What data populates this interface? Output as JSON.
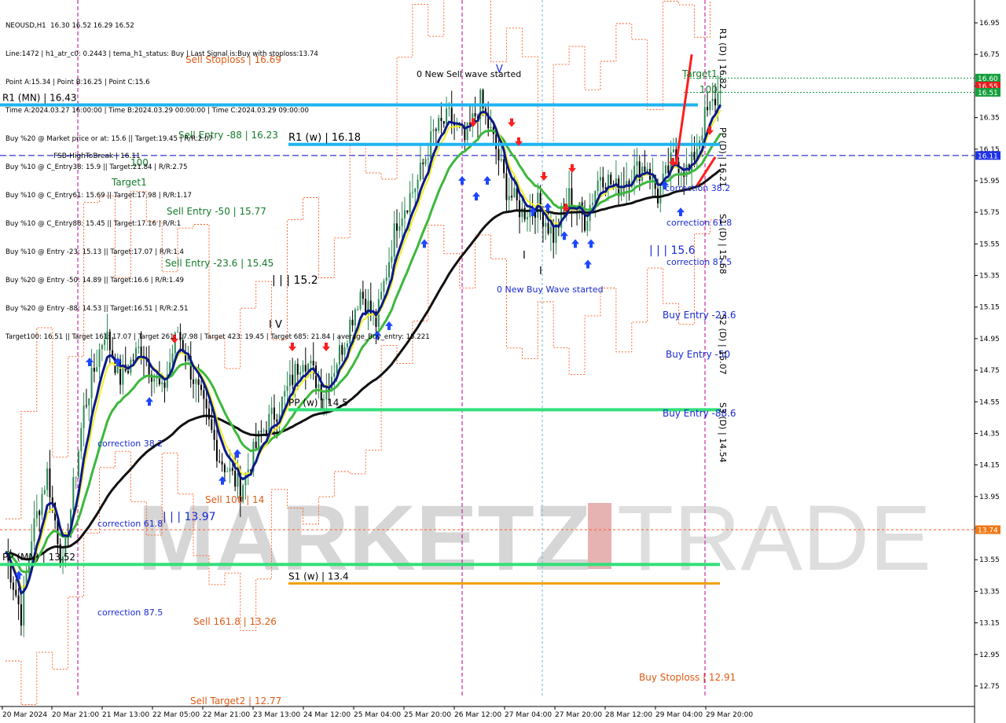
{
  "header": {
    "symbol_line": "NEOUSD,H1  16.30 16.52 16.29 16.52",
    "lines": [
      "Line:1472 | h1_atr_c0: 0.2443 | tema_h1_status: Buy | Last Signal is:Buy with stoploss:13.74",
      "Point A:15.34 | Point B:16.25 | Point C:15.6",
      "Time A:2024.03.27 16:00:00 | Time B:2024.03.29 00:00:00 | Time C:2024.03.29 09:00:00",
      "Buy %20 @ Market price or at: 15.6 || Target:19.45 | R/R:2.07",
      "Buy %10 @ C_Entry38: 15.9 || Target:21.84 | R/R:2.75",
      "Buy %10 @ C_Entry61: 15.69 || Target:17.98 | R/R:1.17",
      "Buy %10 @ C_Entry88: 15.45 || Target:17.16 | R/R:1",
      "Buy %10 @ Entry -23: 15.13 || Target:17.07 | R/R:1.4",
      "Buy %20 @ Entry -50: 14.89 || Target:16.6 | R/R:1.49",
      "Buy %20 @ Entry -88: 14.53 || Target:16.51 | R/R:2.51",
      "Target100: 16.51 || Target 161: 17.07 | Target 261: 17.98 | Target 423: 19.45 | Target 685: 21.84 | average_Buy_entry: 15.221"
    ]
  },
  "watermark": {
    "left": "MARKETZ",
    "right": "TRADE"
  },
  "colors": {
    "bull": "#2e8b57",
    "bear": "#000000",
    "ma_black": "#111111",
    "ma_navy": "#0a1a8a",
    "ma_yellow": "#f2ee1e",
    "ma_green": "#3cb83c",
    "level_blue": "#1eb4f0",
    "level_green": "#32e07a",
    "level_orange": "#f0a000",
    "fsb_dash": "#0000cc",
    "dotted_red": "#ff5a1e",
    "magenta": "#c0008c",
    "arrow_up": "#1e46ff",
    "arrow_down": "#ff1e1e"
  },
  "chart_data": {
    "type": "candlestick",
    "symbol": "NEOUSD",
    "timeframe": "H1",
    "ylim": [
      12.68,
      17.02
    ],
    "y_ticks": [
      16.95,
      16.75,
      16.55,
      16.35,
      16.15,
      15.95,
      15.75,
      15.55,
      15.35,
      15.15,
      14.95,
      14.75,
      14.55,
      14.35,
      14.15,
      13.95,
      13.75,
      13.55,
      13.35,
      13.15,
      12.95,
      12.75
    ],
    "x_labels": [
      "20 Mar 2024",
      "20 Mar 21:00",
      "21 Mar 13:00",
      "22 Mar 05:00",
      "22 Mar 21:00",
      "23 Mar 13:00",
      "24 Mar 12:00",
      "25 Mar 04:00",
      "25 Mar 20:00",
      "26 Mar 12:00",
      "27 Mar 04:00",
      "27 Mar 20:00",
      "28 Mar 12:00",
      "29 Mar 04:00",
      "29 Mar 20:00"
    ],
    "price_tags": [
      {
        "value": 16.6,
        "label": "16.60",
        "color": "#14a03c"
      },
      {
        "value": 16.55,
        "label": "16.55",
        "color": "#e61e1e"
      },
      {
        "value": 16.51,
        "label": "16.51",
        "color": "#14a03c"
      },
      {
        "value": 16.11,
        "label": "16.11",
        "color": "#1e32e6"
      },
      {
        "value": 13.74,
        "label": "13.74",
        "color": "#f07814"
      }
    ],
    "levels": [
      {
        "name": "R1 (w)",
        "value": 16.18,
        "label": "R1 (w) | 16.18"
      },
      {
        "name": "PP (w)",
        "value": 14.5,
        "label": "PP (w) | 14.5"
      },
      {
        "name": "S1 (w)",
        "value": 13.4,
        "label": "S1 (w) | 13.4"
      },
      {
        "name": "PP (MN)",
        "value": 13.52,
        "label": "PP (MN) | 13.52"
      },
      {
        "name": "R1 (MN)",
        "value": 16.43,
        "label": "R1 (MN) | 16.43"
      },
      {
        "name": "FSB-HighToBreak",
        "value": 16.11,
        "label": "FSB-HighToBreak | 16.11"
      }
    ],
    "annotations": {
      "sell_stoploss": "Sell Stoploss | 16.69",
      "sell_entry_88": "Sell Entry -88 | 16.23",
      "sell_entry_50": "Sell Entry -50 | 15.77",
      "sell_entry_236": "Sell Entry -23.6 | 15.45",
      "sell_100": "Sell 100 | 14",
      "sell_1618": "Sell 161.8 | 13.26",
      "sell_target2": "Sell Target2 | 12.77",
      "left_100": "100",
      "left_target1": "Target1",
      "corr382_l": "correction 38.2",
      "corr618_l": "correction 61.8",
      "corr875_l": "correction 87.5",
      "roman_152": "| | | 15.2",
      "roman_1397": "| | | 13.97",
      "roman_iv": "I V",
      "new_sell_wave": "0 New Sell wave started",
      "new_buy_wave": "0 New Buy Wave started",
      "roman_156": "| | | 15.6",
      "corr382_r": "correction 38.2",
      "corr618_r": "correction 61.8",
      "corr875_r": "correction 87.5",
      "buy_entry_236": "Buy Entry -23.6",
      "buy_entry_50": "Buy Entry -50",
      "buy_entry_88": "Buy Entry -88.6",
      "buy_stoploss": "Buy Stoploss | 12.91",
      "target1_r": "Target1",
      "r_100": "100",
      "r1_d": "R1 (D) | 16.82",
      "pp_d": "PP (D) | 16.21",
      "s1_d": "S1 (D) | 15.68",
      "s2_d": "S2 (D) | 15.07",
      "s3_d": "S3 (D) | 14.54",
      "roman_v": "V",
      "roman_i_a": "I",
      "roman_i_b": "I"
    },
    "waypoints": [
      [
        0,
        13.6
      ],
      [
        6,
        13.2
      ],
      [
        10,
        13.7
      ],
      [
        16,
        14.1
      ],
      [
        22,
        13.5
      ],
      [
        30,
        14.5
      ],
      [
        38,
        15.0
      ],
      [
        44,
        14.7
      ],
      [
        52,
        14.9
      ],
      [
        60,
        14.6
      ],
      [
        66,
        15.0
      ],
      [
        74,
        14.6
      ],
      [
        82,
        14.2
      ],
      [
        90,
        14.0
      ],
      [
        98,
        14.35
      ],
      [
        106,
        14.55
      ],
      [
        114,
        14.85
      ],
      [
        122,
        14.6
      ],
      [
        130,
        14.95
      ],
      [
        136,
        15.25
      ],
      [
        142,
        15.05
      ],
      [
        150,
        15.7
      ],
      [
        158,
        15.95
      ],
      [
        164,
        16.25
      ],
      [
        170,
        16.35
      ],
      [
        176,
        16.2
      ],
      [
        182,
        16.45
      ],
      [
        188,
        16.15
      ],
      [
        192,
        15.9
      ],
      [
        198,
        15.75
      ],
      [
        204,
        15.8
      ],
      [
        210,
        15.6
      ],
      [
        216,
        15.85
      ],
      [
        222,
        15.7
      ],
      [
        228,
        16.0
      ],
      [
        234,
        15.9
      ],
      [
        240,
        16.0
      ],
      [
        246,
        16.05
      ],
      [
        250,
        15.85
      ],
      [
        256,
        16.1
      ],
      [
        262,
        16.0
      ],
      [
        268,
        16.35
      ],
      [
        274,
        16.52
      ]
    ]
  }
}
